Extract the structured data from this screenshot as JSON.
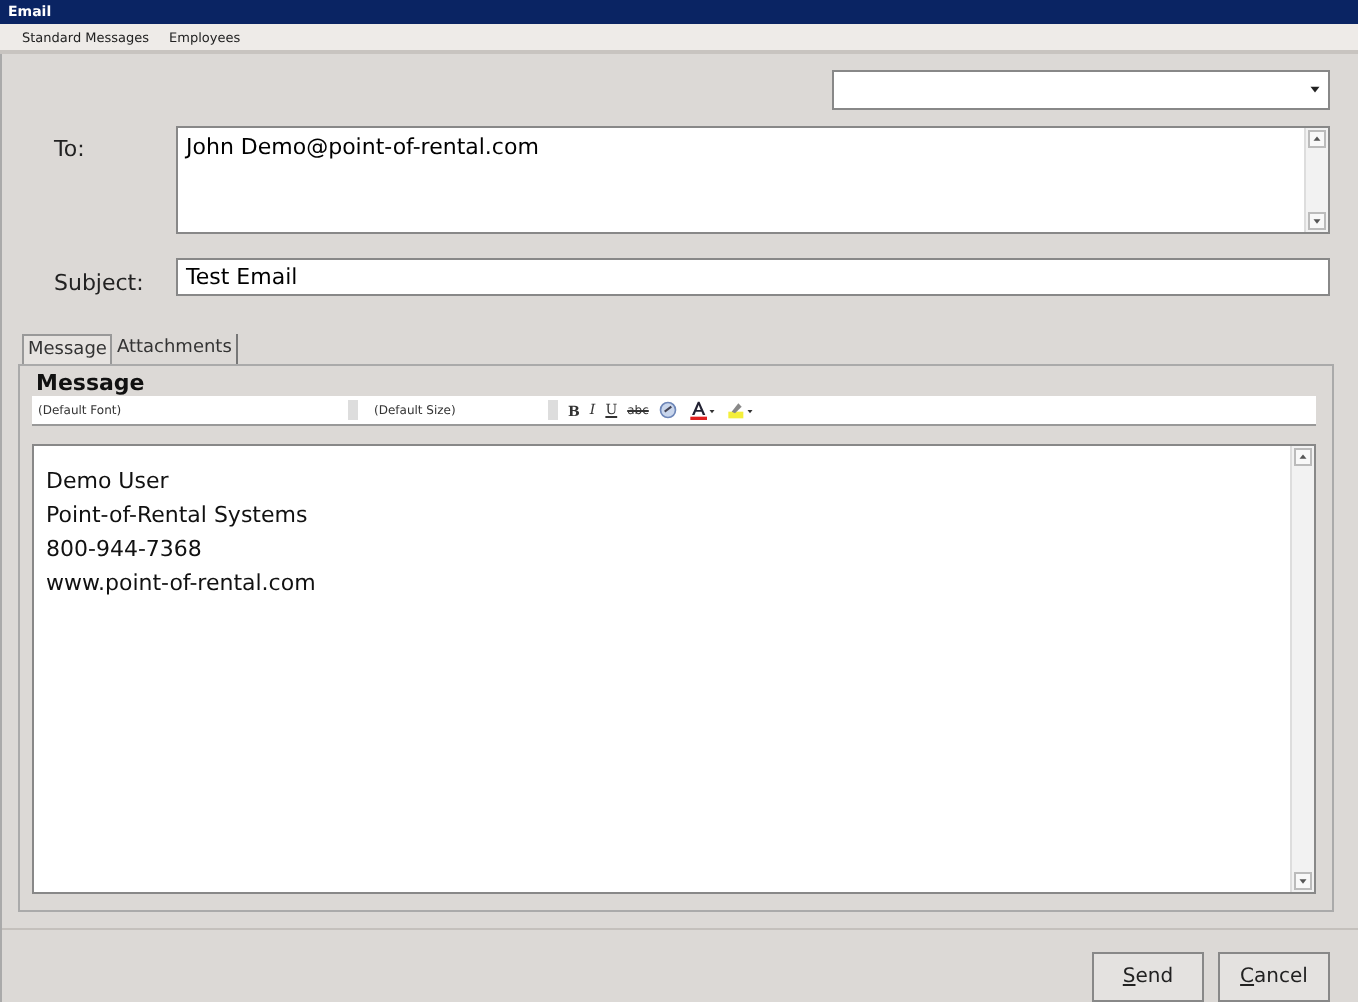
{
  "window": {
    "title": "Email"
  },
  "menu": [
    "Standard Messages",
    "Employees"
  ],
  "to": {
    "label": "To:",
    "value": "John Demo@point-of-rental.com"
  },
  "subject": {
    "label": "Subject:",
    "value": "Test Email"
  },
  "tabs": [
    {
      "label": "Message",
      "selected": true
    },
    {
      "label": "Attachments",
      "selected": false
    }
  ],
  "message": {
    "heading": "Message",
    "font": "(Default Font)",
    "size": "(Default Size)",
    "format_buttons": [
      {
        "kind": "bold",
        "label": "B"
      },
      {
        "kind": "italic",
        "label": "I"
      },
      {
        "kind": "underline",
        "label": "U"
      },
      {
        "kind": "strike",
        "label": "abc"
      },
      {
        "kind": "link"
      },
      {
        "kind": "font-color"
      },
      {
        "kind": "highlight"
      }
    ],
    "body": [
      "Demo User",
      "Point-of-Rental Systems",
      "800-944-7368",
      "www.point-of-rental.com"
    ]
  },
  "buttons": [
    {
      "label": "Send"
    },
    {
      "label": "Cancel"
    }
  ]
}
